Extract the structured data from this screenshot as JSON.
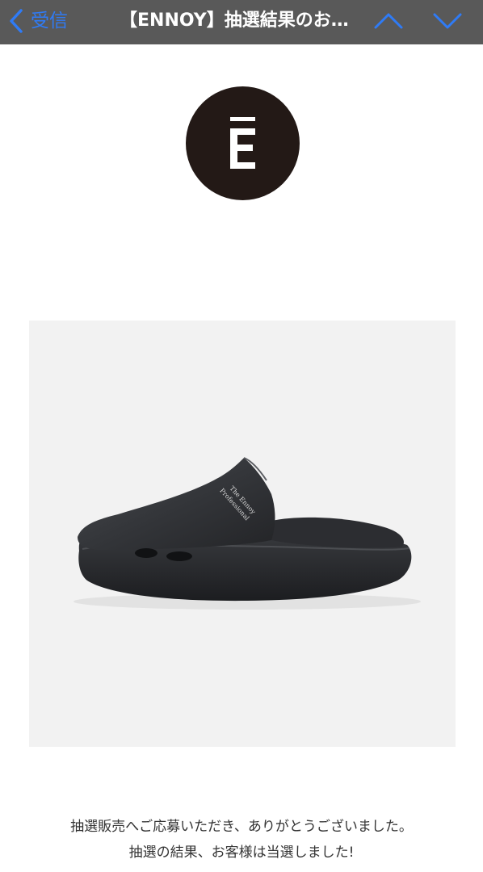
{
  "nav": {
    "back_label": "受信",
    "back_icon": "chevron-left-icon",
    "title": "【ENNOY】抽選結果のお…",
    "up_icon": "chevron-up-icon",
    "down_icon": "chevron-down-icon",
    "bar_color": "#595959",
    "accent_color": "#2f7bf6"
  },
  "logo": {
    "letter": "E",
    "background_color": "#231916"
  },
  "product": {
    "print_line1": "The Ennoy",
    "print_line2": "Professional"
  },
  "message": {
    "line1": "抽選販売へご応募いただき、ありがとうございました。",
    "line2": "抽選の結果、お客様は当選しました!"
  }
}
